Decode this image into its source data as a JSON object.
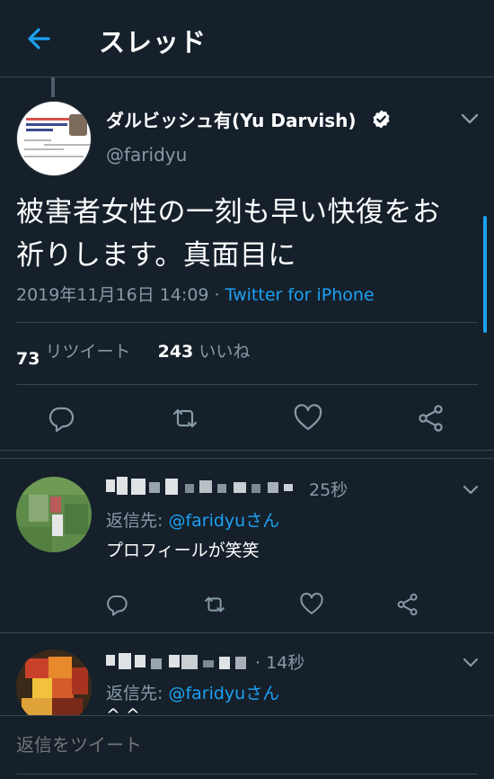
{
  "header": {
    "title": "スレッド"
  },
  "tweet": {
    "author_name": "ダルビッシュ有(Yu Darvish)",
    "handle": "@faridyu",
    "text_line1": "被害者女性の一刻も早い快復をお",
    "text_line2": "祈りします。真面目に",
    "timestamp": "2019年11月16日 14:09",
    "separator": " · ",
    "source": "Twitter for iPhone",
    "retweet_count": "73",
    "retweet_label": "リツイート",
    "like_count": "243",
    "like_label": "いいね"
  },
  "replies": [
    {
      "time": "25秒",
      "reply_prefix": "返信先: ",
      "reply_handle": "@faridyuさん",
      "text": "プロフィールが笑笑"
    },
    {
      "time": "14秒",
      "reply_prefix": "返信先: ",
      "reply_handle": "@faridyuさん",
      "text": "^ ^"
    }
  ],
  "compose": {
    "placeholder": "返信をツイート"
  },
  "colors": {
    "background": "#15202b",
    "accent": "#1da1f2",
    "secondary_text": "#8899a6",
    "border": "#38444d"
  },
  "icons": [
    "back-arrow-icon",
    "verified-badge-icon",
    "chevron-down-icon",
    "reply-icon",
    "retweet-icon",
    "like-icon",
    "share-icon"
  ]
}
